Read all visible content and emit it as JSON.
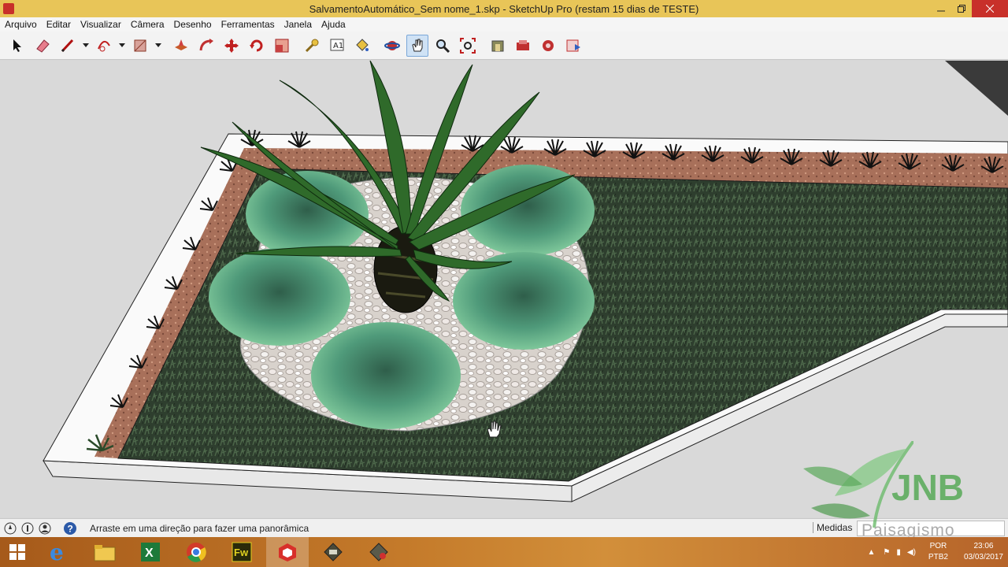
{
  "window": {
    "title": "SalvamentoAutomático_Sem nome_1.skp - SketchUp Pro (restam 15 dias de TESTE)"
  },
  "menu": {
    "items": [
      "Arquivo",
      "Editar",
      "Visualizar",
      "Câmera",
      "Desenho",
      "Ferramentas",
      "Janela",
      "Ajuda"
    ]
  },
  "toolbar": {
    "tools": [
      "select-icon",
      "eraser-icon",
      "pencil-icon",
      "arc-icon",
      "rectangle-icon",
      "push-pull-icon",
      "follow-me-icon",
      "move-icon",
      "rotate-icon",
      "scale-icon",
      "tape-measure-icon",
      "text-icon",
      "paint-bucket-icon",
      "orbit-icon",
      "pan-icon",
      "zoom-icon",
      "zoom-extents-icon",
      "warehouse-icon",
      "extension-icon",
      "components-icon",
      "layout-icon"
    ],
    "active_tool": "pan-icon"
  },
  "status": {
    "message": "Arraste em uma direção para fazer uma panorâmica",
    "measures_label": "Medidas",
    "measures_value": ""
  },
  "taskbar": {
    "apps": [
      "ie-icon",
      "file-explorer-icon",
      "excel-icon",
      "chrome-icon",
      "fireworks-icon",
      "sketchup-icon",
      "app-icon",
      "app-icon-2"
    ],
    "active_app": "sketchup-icon",
    "language": "POR",
    "keyboard": "PTB2",
    "time": "23:06",
    "date": "03/03/2017"
  },
  "watermark": {
    "brand": "JNB",
    "sub": "Paisagismo"
  },
  "colors": {
    "titlebar": "#e8c558",
    "close_button": "#c8302a",
    "taskbar": "#c47a2a",
    "grass": "#2c3d2c",
    "agave": "#4f9a7a"
  }
}
